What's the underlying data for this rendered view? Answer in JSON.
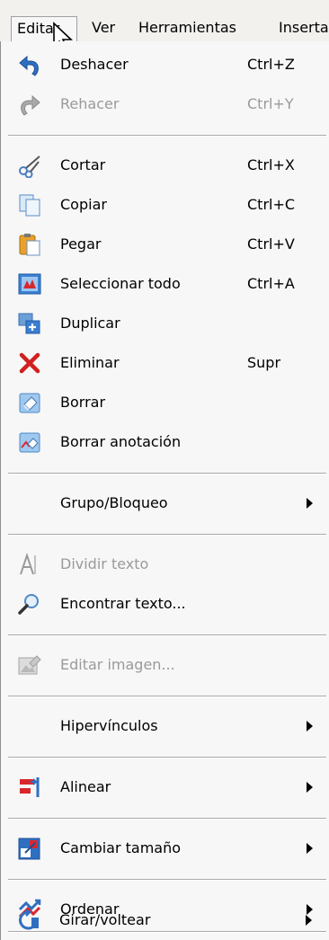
{
  "menubar": {
    "items": [
      "Editar",
      "Ver",
      "Herramientas",
      "Insertar"
    ]
  },
  "menu": {
    "undo": {
      "label": "Deshacer",
      "shortcut": "Ctrl+Z"
    },
    "redo": {
      "label": "Rehacer",
      "shortcut": "Ctrl+Y"
    },
    "cut": {
      "label": "Cortar",
      "shortcut": "Ctrl+X"
    },
    "copy": {
      "label": "Copiar",
      "shortcut": "Ctrl+C"
    },
    "paste": {
      "label": "Pegar",
      "shortcut": "Ctrl+V"
    },
    "select_all": {
      "label": "Seleccionar todo",
      "shortcut": "Ctrl+A"
    },
    "duplicate": {
      "label": "Duplicar"
    },
    "delete": {
      "label": "Eliminar",
      "shortcut": "Supr"
    },
    "erase": {
      "label": "Borrar"
    },
    "erase_annotation": {
      "label": "Borrar anotación"
    },
    "group_lock": {
      "label": "Grupo/Bloqueo"
    },
    "split_text": {
      "label": "Dividir texto"
    },
    "find_text": {
      "label": "Encontrar texto..."
    },
    "edit_image": {
      "label": "Editar imagen..."
    },
    "hyperlinks": {
      "label": "Hipervínculos"
    },
    "align": {
      "label": "Alinear"
    },
    "resize": {
      "label": "Cambiar tamaño"
    },
    "order": {
      "label": "Ordenar"
    },
    "rotate_flip": {
      "label": "Girar/voltear"
    }
  }
}
